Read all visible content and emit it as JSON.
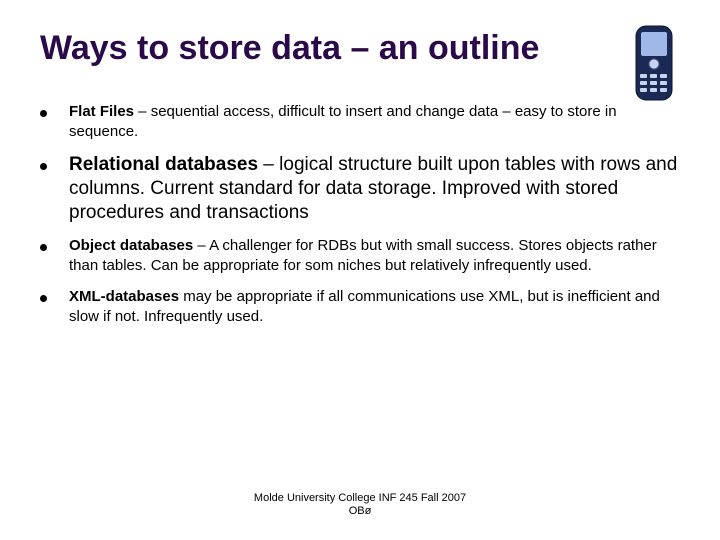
{
  "title": "Ways to store data – an outline",
  "bullets": {
    "b1_bold": "Flat Files",
    "b1_rest": " – sequential access, difficult to insert and change data – easy to store in sequence.",
    "b2_bold": "Relational databases",
    "b2_rest": " – logical structure built upon tables with rows and columns. Current standard for data storage. Improved with stored procedures and transactions",
    "b3_bold": "Object databases",
    "b3_rest": " – A challenger for RDBs but with small success. Stores objects rather than tables. Can be appropriate for som niches but relatively infrequently used.",
    "b4_bold": "XML-databases",
    "b4_rest": " may be appropriate if all communications use XML, but is inefficient and slow if not. Infrequently used."
  },
  "footer": {
    "line1": "Molde University College INF 245 Fall 2007",
    "line2": "OBø"
  }
}
